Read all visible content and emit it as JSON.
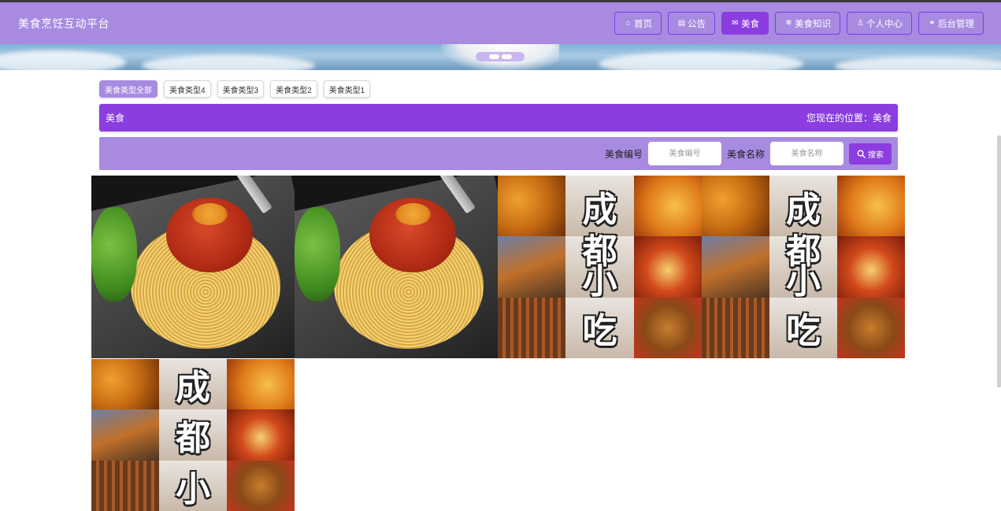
{
  "header": {
    "brand": "美食烹饪互动平台",
    "nav": [
      {
        "label": "首页",
        "icon": "home-icon",
        "glyph": "⌂"
      },
      {
        "label": "公告",
        "icon": "notice-icon",
        "glyph": "▤"
      },
      {
        "label": "美食",
        "icon": "mail-icon",
        "glyph": "✉",
        "active": true
      },
      {
        "label": "美食知识",
        "icon": "snowflake-icon",
        "glyph": "❄"
      },
      {
        "label": "个人中心",
        "icon": "user-icon",
        "glyph": "♙"
      },
      {
        "label": "后台管理",
        "icon": "link-icon",
        "glyph": "⚭"
      }
    ]
  },
  "categories": [
    "美食类型全部",
    "美食类型4",
    "美食类型3",
    "美食类型2",
    "美食类型1"
  ],
  "location": {
    "title": "美食",
    "prefix": "您现在的位置：",
    "current": "美食"
  },
  "search": {
    "code_label": "美食编号",
    "code_placeholder": "美食编号",
    "name_label": "美食名称",
    "name_placeholder": "美食名称",
    "button_label": "搜索"
  },
  "food_items": [
    {
      "image": "spaghetti-bolognese"
    },
    {
      "image": "spaghetti-bolognese"
    },
    {
      "image": "chengdu-snacks-collage",
      "overlay_text": [
        "成",
        "都",
        "小",
        "吃"
      ]
    },
    {
      "image": "chengdu-snacks-collage",
      "overlay_text": [
        "成",
        "都",
        "小",
        "吃"
      ]
    }
  ],
  "colors": {
    "nav_bg": "#a88be0",
    "accent": "#8b3ddf",
    "search_bg": "#a88be0"
  }
}
